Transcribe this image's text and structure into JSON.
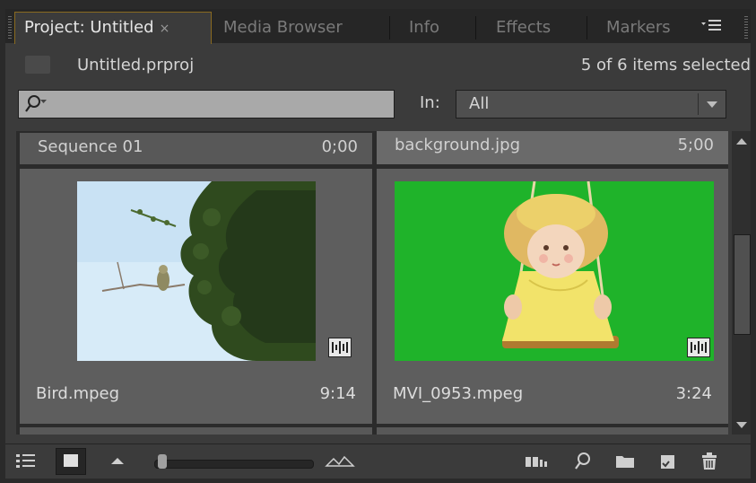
{
  "tabs": [
    {
      "label": "Project: Untitled",
      "active": true
    },
    {
      "label": "Media Browser",
      "active": false
    },
    {
      "label": "Info",
      "active": false
    },
    {
      "label": "Effects",
      "active": false
    },
    {
      "label": "Markers",
      "active": false
    }
  ],
  "tab_close_glyph": "×",
  "project": {
    "file_name": "Untitled.prproj",
    "selection_status": "5 of 6 items selected"
  },
  "search": {
    "placeholder": "",
    "in_label": "In:",
    "in_value": "All"
  },
  "items": [
    {
      "name": "Sequence 01",
      "duration": "0;00"
    },
    {
      "name": "background.jpg",
      "duration": "5;00"
    },
    {
      "name": "Bird.mpeg",
      "duration": "9:14",
      "thumbnail": "bird-on-branch"
    },
    {
      "name": "MVI_0953.mpeg",
      "duration": "3:24",
      "thumbnail": "doll-on-swing-greenscreen"
    }
  ],
  "icons": {
    "panel_menu": "panel-menu-icon",
    "search": "search-icon",
    "list_view": "list-view-icon",
    "icon_view": "icon-view-icon",
    "zoom_out": "zoom-out-icon",
    "zoom_in": "zoom-in-icon",
    "automate": "automate-to-sequence-icon",
    "find": "find-icon",
    "new_bin": "new-bin-icon",
    "new_item": "new-item-icon",
    "clear": "trash-icon"
  },
  "thumbnail_zoom": 0.05,
  "colors": {
    "panel_bg": "#3b3b3b",
    "active_tab_border": "#8a6a20",
    "green_screen": "#1fb32a",
    "sky": "#cfe6f7"
  }
}
